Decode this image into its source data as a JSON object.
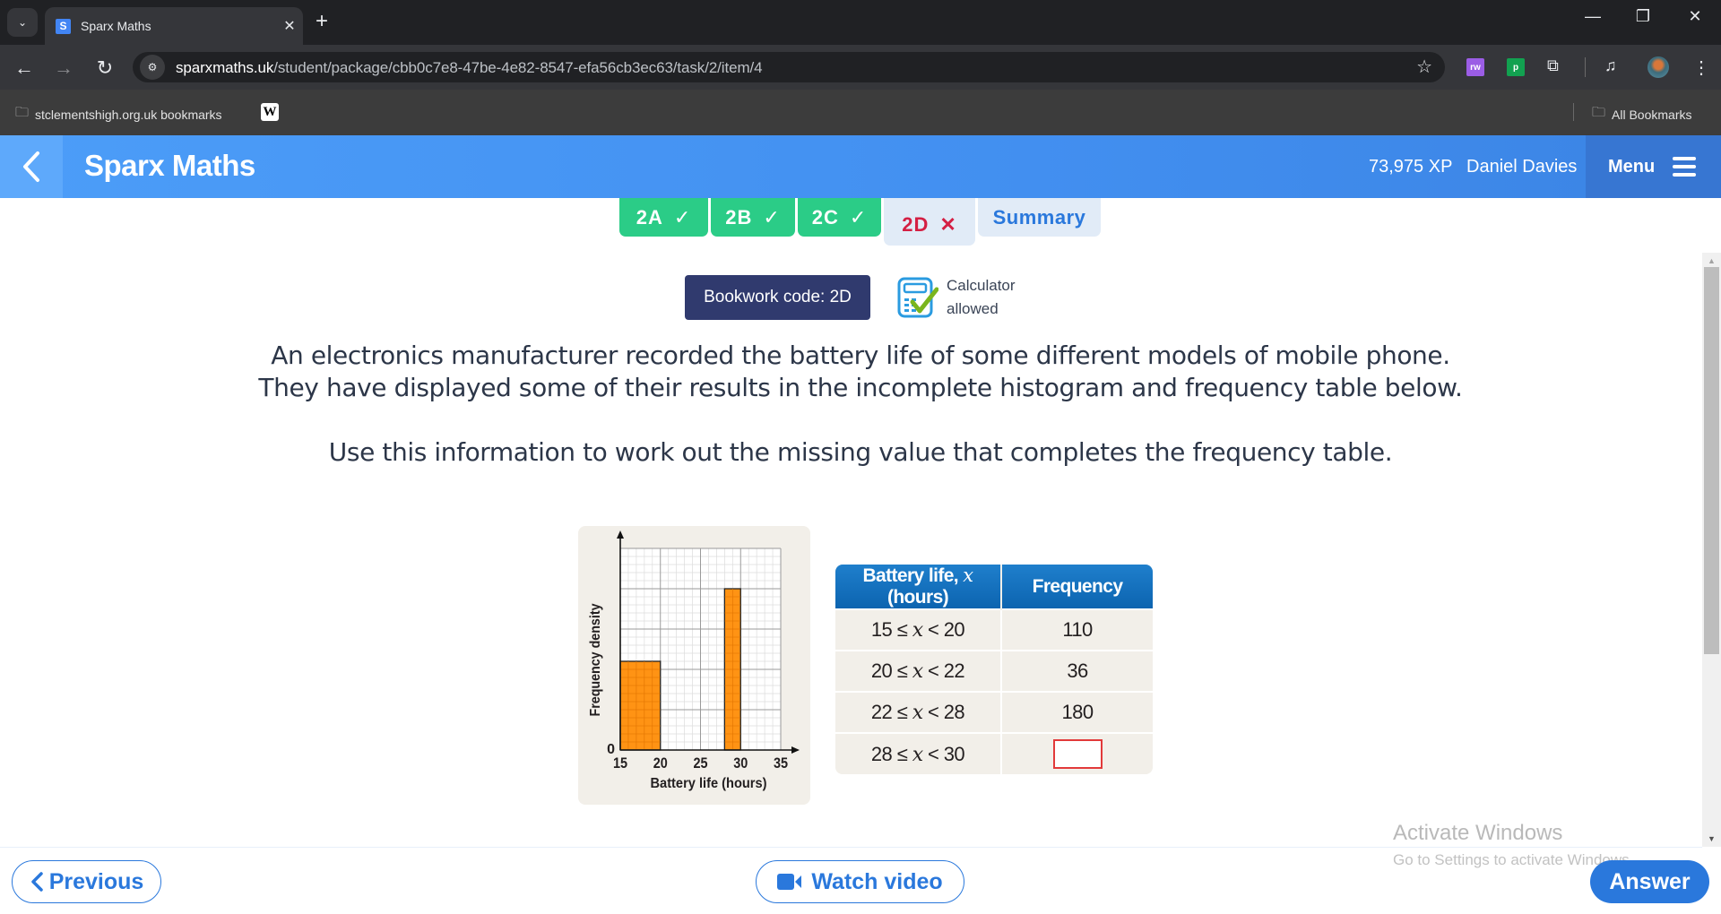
{
  "browser": {
    "tab_title": "Sparx Maths",
    "favicon_letter": "S",
    "url_host": "sparxmaths.uk",
    "url_path": "/student/package/cbb0c7e8-47be-4e82-8547-efa56cb3ec63/task/2/item/4",
    "extensions": [
      "rw",
      "p"
    ],
    "bookmarks": [
      {
        "label": "stclementshigh.org.uk bookmarks",
        "icon": "managed-folder-icon"
      },
      {
        "label": "W",
        "icon": "wikipedia-icon"
      }
    ],
    "all_bookmarks_label": "All Bookmarks"
  },
  "header": {
    "brand": "Sparx Maths",
    "xp": "73,975 XP",
    "user_name": "Daniel Davies",
    "menu_label": "Menu",
    "brand_color": "#4a9bf7"
  },
  "task_tabs": [
    {
      "label": "2A",
      "status": "correct",
      "mark": "✓"
    },
    {
      "label": "2B",
      "status": "correct",
      "mark": "✓"
    },
    {
      "label": "2C",
      "status": "correct",
      "mark": "✓"
    },
    {
      "label": "2D",
      "status": "incorrect",
      "mark": "✕"
    },
    {
      "label": "Summary",
      "status": "summary",
      "mark": ""
    }
  ],
  "bookwork_code": "Bookwork code: 2D",
  "calculator": {
    "line1": "Calculator",
    "line2": "allowed"
  },
  "question": {
    "line1": "An electronics manufacturer recorded the battery life of some different models of mobile phone.",
    "line2": "They have displayed some of their results in the incomplete histogram and frequency table below.",
    "line3": "Use this information to work out the missing value that completes the frequency table."
  },
  "chart_data": {
    "type": "bar",
    "subtype": "histogram",
    "xlabel": "Battery life (hours)",
    "ylabel": "Frequency density",
    "xlim": [
      15,
      35
    ],
    "ylim": [
      0,
      50
    ],
    "x_ticks": [
      15,
      20,
      25,
      30,
      35
    ],
    "y_ticks_labeled": [
      0
    ],
    "y_major_step": 10,
    "x_major_step": 5,
    "minor_subdivisions": 5,
    "grid": true,
    "bars": [
      {
        "from": 15,
        "to": 20,
        "density": 22
      },
      {
        "from": 28,
        "to": 30,
        "density": 40
      }
    ],
    "bar_color": "#ff8a00"
  },
  "table": {
    "headers": [
      "Battery life, x (hours)",
      "Frequency"
    ],
    "header_prefix": "Battery life, ",
    "header_var": "x",
    "header_suffix": " (hours)",
    "rows": [
      {
        "lower": "15",
        "upper": "20",
        "var": "x",
        "frequency": "110"
      },
      {
        "lower": "20",
        "upper": "22",
        "var": "x",
        "frequency": "36"
      },
      {
        "lower": "22",
        "upper": "28",
        "var": "x",
        "frequency": "180"
      },
      {
        "lower": "28",
        "upper": "30",
        "var": "x",
        "frequency": ""
      }
    ],
    "le_symbol": "≤",
    "lt_symbol": "<"
  },
  "footer": {
    "previous_label": "Previous",
    "watch_video_label": "Watch video",
    "answer_label": "Answer"
  },
  "watermark": {
    "line1": "Activate Windows",
    "line2": "Go to Settings to activate Windows."
  }
}
